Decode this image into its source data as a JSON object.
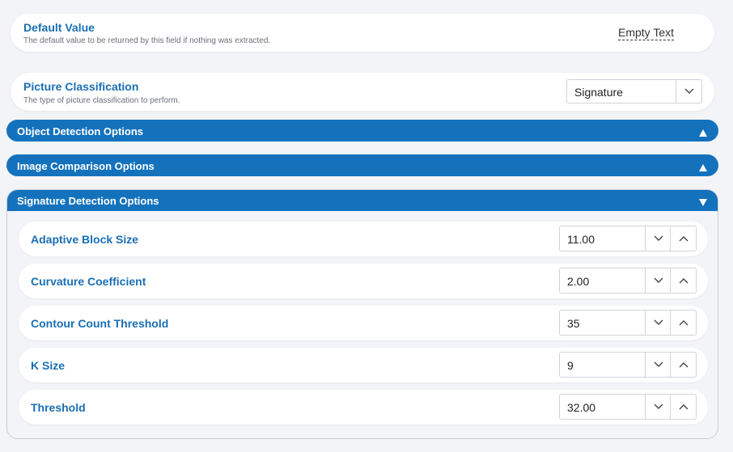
{
  "default_value": {
    "title": "Default Value",
    "description": "The default value to be returned by this field if nothing was extracted.",
    "value": "Empty Text"
  },
  "picture_classification": {
    "title": "Picture Classification",
    "description": "The type of picture classification to perform.",
    "selected": "Signature"
  },
  "sections": {
    "object_detection": "Object Detection Options",
    "image_comparison": "Image Comparison Options",
    "signature_detection": "Signature Detection Options"
  },
  "signature_options": [
    {
      "label": "Adaptive Block Size",
      "value": "11.00"
    },
    {
      "label": "Curvature Coefficient",
      "value": "2.00"
    },
    {
      "label": "Contour Count Threshold",
      "value": "35"
    },
    {
      "label": "K Size",
      "value": "9"
    },
    {
      "label": "Threshold",
      "value": "32.00"
    }
  ],
  "colors": {
    "accent": "#1472bd",
    "label_blue": "#1a6fb5",
    "background": "#f3f4f8"
  }
}
